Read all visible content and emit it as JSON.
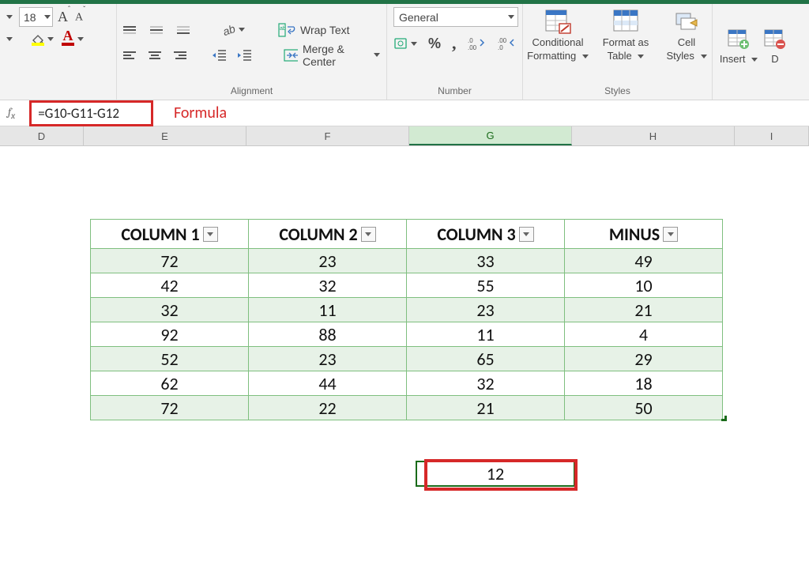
{
  "ribbon": {
    "font": {
      "size": "18",
      "increaseA": "A",
      "decreaseA": "A"
    },
    "alignment": {
      "wrap_label": "Wrap Text",
      "merge_label": "Merge & Center",
      "group_label": "Alignment"
    },
    "number": {
      "format": "General",
      "percent": "%",
      "comma": ",",
      "group_label": "Number"
    },
    "styles": {
      "cond_line1": "Conditional",
      "cond_line2": "Formatting",
      "fmt_line1": "Format as",
      "fmt_line2": "Table",
      "cell_line1": "Cell",
      "cell_line2": "Styles",
      "group_label": "Styles"
    },
    "cells": {
      "insert": "Insert",
      "delete_initial": "D"
    }
  },
  "formula_bar": {
    "formula": "=G10-G11-G12",
    "annotation": "Formula"
  },
  "columns": [
    "D",
    "E",
    "F",
    "G",
    "H",
    "I"
  ],
  "table": {
    "headers": [
      "COLUMN 1",
      "COLUMN 2",
      "COLUMN 3",
      "MINUS"
    ],
    "rows": [
      [
        72,
        23,
        33,
        49
      ],
      [
        42,
        32,
        55,
        10
      ],
      [
        32,
        11,
        23,
        21
      ],
      [
        92,
        88,
        11,
        4
      ],
      [
        52,
        23,
        65,
        29
      ],
      [
        62,
        44,
        32,
        18
      ],
      [
        72,
        22,
        21,
        50
      ]
    ]
  },
  "result": "12",
  "chart_data": {
    "type": "table",
    "title": "",
    "columns": [
      "COLUMN 1",
      "COLUMN 2",
      "COLUMN 3",
      "MINUS"
    ],
    "rows": [
      [
        72,
        23,
        33,
        49
      ],
      [
        42,
        32,
        55,
        10
      ],
      [
        32,
        11,
        23,
        21
      ],
      [
        92,
        88,
        11,
        4
      ],
      [
        52,
        23,
        65,
        29
      ],
      [
        62,
        44,
        32,
        18
      ],
      [
        72,
        22,
        21,
        50
      ]
    ],
    "formula_cell": {
      "address": "G",
      "formula": "=G10-G11-G12",
      "value": 12
    }
  }
}
